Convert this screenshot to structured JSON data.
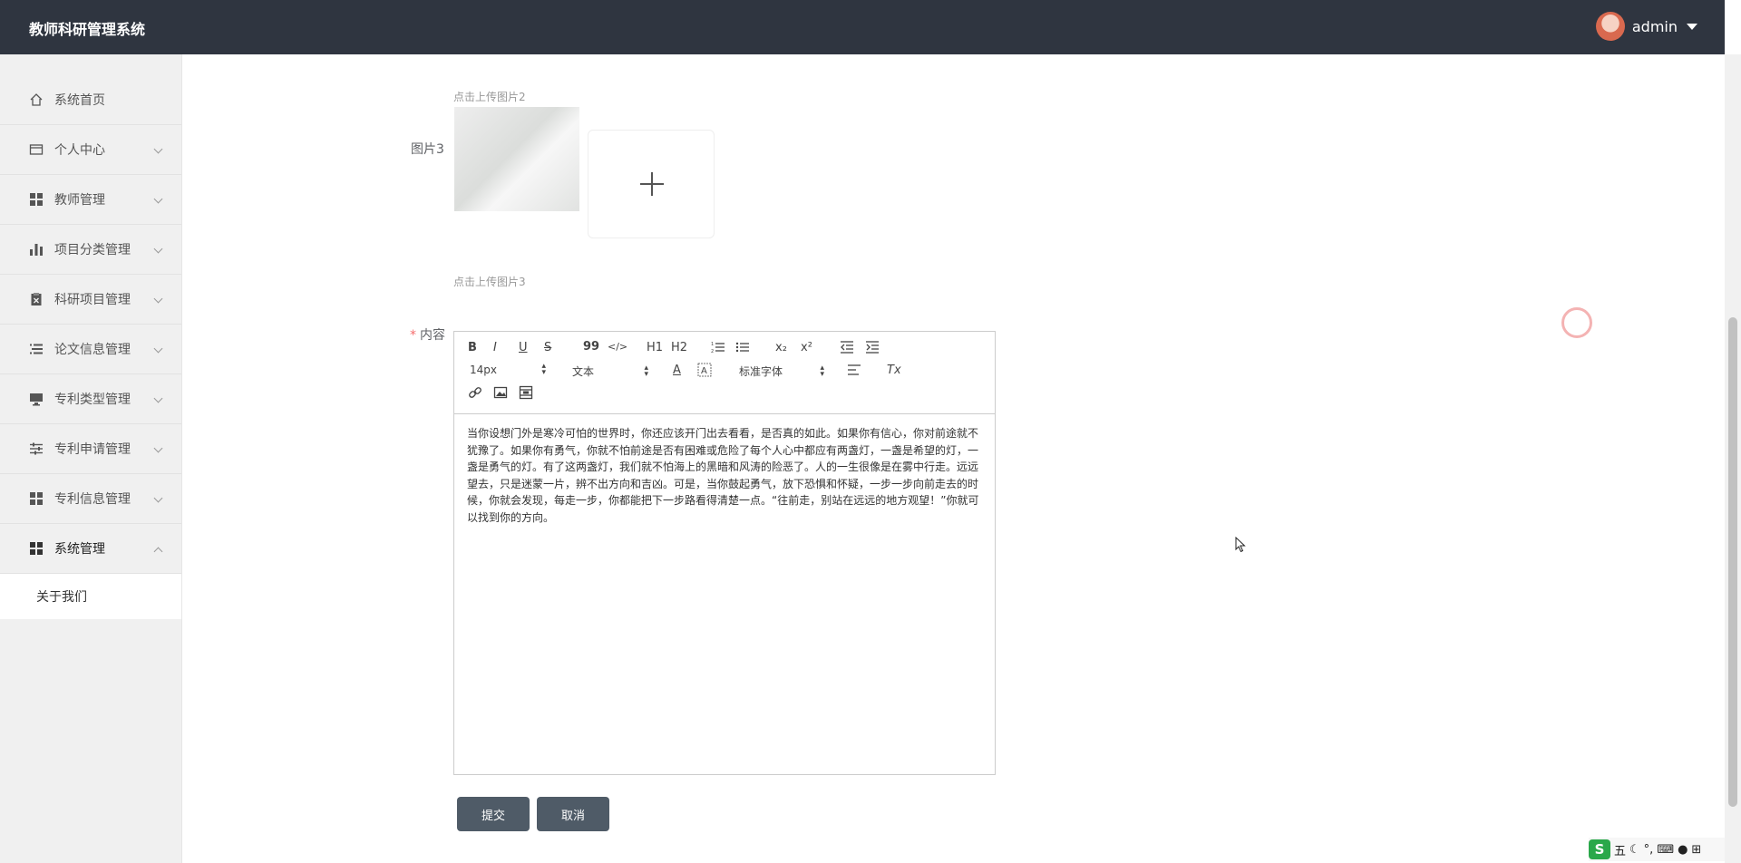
{
  "app": {
    "title": "教师科研管理系统"
  },
  "user": {
    "name": "admin"
  },
  "sidebar": {
    "items": [
      {
        "label": "系统首页",
        "icon": "home-icon"
      },
      {
        "label": "个人中心",
        "icon": "card-icon"
      },
      {
        "label": "教师管理",
        "icon": "grid-icon"
      },
      {
        "label": "项目分类管理",
        "icon": "bar-chart-icon"
      },
      {
        "label": "科研项目管理",
        "icon": "clipboard-icon"
      },
      {
        "label": "论文信息管理",
        "icon": "list-icon"
      },
      {
        "label": "专利类型管理",
        "icon": "monitor-icon"
      },
      {
        "label": "专利申请管理",
        "icon": "sliders-icon"
      },
      {
        "label": "专利信息管理",
        "icon": "grid-icon"
      },
      {
        "label": "系统管理",
        "icon": "grid-icon"
      }
    ],
    "submenu": [
      {
        "label": "关于我们"
      }
    ]
  },
  "form": {
    "hint_image2": "点击上传图片2",
    "label_image3": "图片3",
    "hint_image3": "点击上传图片3",
    "label_content": "内容",
    "required_mark": "*"
  },
  "editor": {
    "toolbar": {
      "bold": "B",
      "italic": "I",
      "underline": "U",
      "strike": "S",
      "quote": "99",
      "code": "</>",
      "h1": "H1",
      "h2": "H2",
      "sub": "x₂",
      "sup": "x²",
      "size_value": "14px",
      "format_value": "文本",
      "font_value": "标准字体",
      "clear": "Tx",
      "font_color": "A"
    },
    "content": "当你设想门外是寒冷可怕的世界时，你还应该开门出去看看，是否真的如此。如果你有信心，你对前途就不犹豫了。如果你有勇气，你就不怕前途是否有困难或危险了每个人心中都应有两盏灯，一盏是希望的灯，一盏是勇气的灯。有了这两盏灯，我们就不怕海上的黑暗和风涛的险恶了。人的一生很像是在雾中行走。远远望去，只是迷蒙一片，辨不出方向和吉凶。可是，当你鼓起勇气，放下恐惧和怀疑，一步一步向前走去的时候，你就会发现，每走一步，你都能把下一步路看得清楚一点。“往前走，别站在远远的地方观望！”你就可以找到你的方向。"
  },
  "buttons": {
    "submit": "提交",
    "cancel": "取消"
  },
  "ime": {
    "mode": "五"
  }
}
